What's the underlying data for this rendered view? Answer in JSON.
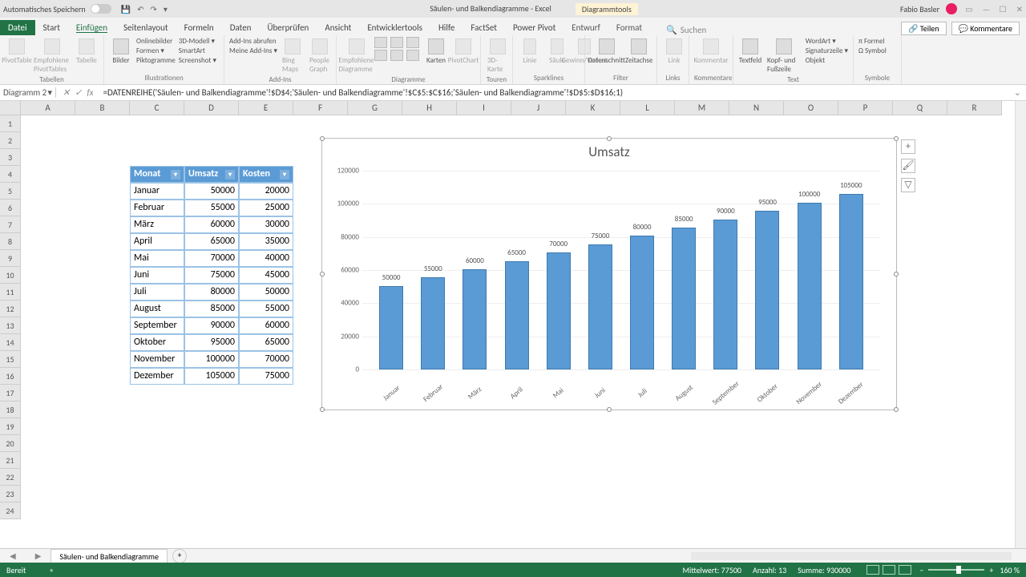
{
  "title": {
    "autosave": "Automatisches Speichern",
    "doc": "Säulen- und Balkendiagramme - Excel",
    "chart_tools": "Diagrammtools",
    "user": "Fabio Basler"
  },
  "tabs": {
    "file": "Datei",
    "list": [
      "Start",
      "Einfügen",
      "Seitenlayout",
      "Formeln",
      "Daten",
      "Überprüfen",
      "Ansicht",
      "Entwicklertools",
      "Hilfe",
      "FactSet",
      "Power Pivot",
      "Entwurf",
      "Format"
    ],
    "active": "Einfügen",
    "search": "Suchen",
    "share": "Teilen",
    "comments": "Kommentare"
  },
  "ribbon": {
    "g1": {
      "label": "Tabellen",
      "a": "PivotTable",
      "b": "Empfohlene PivotTables",
      "c": "Tabelle"
    },
    "g2": {
      "label": "Illustrationen",
      "a": "Bilder",
      "b": "Onlinebilder",
      "c": "Formen ▾",
      "d": "Piktogramme",
      "e": "3D-Modell ▾",
      "f": "SmartArt",
      "g": "Screenshot ▾"
    },
    "g3": {
      "label": "Add-Ins",
      "a": "Add-Ins abrufen",
      "b": "Meine Add-Ins ▾",
      "c": "Bing Maps",
      "d": "People Graph"
    },
    "g4": {
      "label": "Diagramme",
      "a": "Empfohlene Diagramme",
      "b": "Karten",
      "c": "PivotChart"
    },
    "g5": {
      "label": "Touren",
      "a": "3D-Karte"
    },
    "g6": {
      "label": "Sparklines",
      "a": "Linie",
      "b": "Säule",
      "c": "Gewinn/Verlust"
    },
    "g7": {
      "label": "Filter",
      "a": "Datenschnitt",
      "b": "Zeitachse"
    },
    "g8": {
      "label": "Links",
      "a": "Link"
    },
    "g9": {
      "label": "Kommentare",
      "a": "Kommentar"
    },
    "g10": {
      "label": "Text",
      "a": "Textfeld",
      "b": "Kopf- und Fußzeile",
      "c": "WordArt ▾",
      "d": "Signaturzeile ▾",
      "e": "Objekt"
    },
    "g11": {
      "label": "Symbole",
      "a": "Formel",
      "b": "Symbol"
    }
  },
  "namebox": "Diagramm 2",
  "formula": "=DATENREIHE('Säulen- und Balkendiagramme'!$D$4;'Säulen- und Balkendiagramme'!$C$5:$C$16;'Säulen- und Balkendiagramme'!$D$5:$D$16;1)",
  "columns": [
    "A",
    "B",
    "C",
    "D",
    "E",
    "F",
    "G",
    "H",
    "I",
    "J",
    "K",
    "L",
    "M",
    "N",
    "O",
    "P",
    "Q",
    "R"
  ],
  "table": {
    "headers": [
      "Monat",
      "Umsatz",
      "Kosten"
    ],
    "rows": [
      [
        "Januar",
        "50000",
        "20000"
      ],
      [
        "Februar",
        "55000",
        "25000"
      ],
      [
        "März",
        "60000",
        "30000"
      ],
      [
        "April",
        "65000",
        "35000"
      ],
      [
        "Mai",
        "70000",
        "40000"
      ],
      [
        "Juni",
        "75000",
        "45000"
      ],
      [
        "Juli",
        "80000",
        "50000"
      ],
      [
        "August",
        "85000",
        "55000"
      ],
      [
        "September",
        "90000",
        "60000"
      ],
      [
        "Oktober",
        "95000",
        "65000"
      ],
      [
        "November",
        "100000",
        "70000"
      ],
      [
        "Dezember",
        "105000",
        "75000"
      ]
    ]
  },
  "chart_data": {
    "type": "bar",
    "title": "Umsatz",
    "categories": [
      "Januar",
      "Februar",
      "März",
      "April",
      "Mai",
      "Juni",
      "Juli",
      "August",
      "September",
      "Oktober",
      "November",
      "Dezember"
    ],
    "values": [
      50000,
      55000,
      60000,
      65000,
      70000,
      75000,
      80000,
      85000,
      90000,
      95000,
      100000,
      105000
    ],
    "ylim": [
      0,
      120000
    ],
    "yticks": [
      0,
      20000,
      40000,
      60000,
      80000,
      100000,
      120000
    ]
  },
  "sheet": {
    "name": "Säulen- und Balkendiagramme"
  },
  "status": {
    "ready": "Bereit",
    "avg": "Mittelwert: 77500",
    "count": "Anzahl: 13",
    "sum": "Summe: 930000",
    "zoom": "160 %"
  }
}
